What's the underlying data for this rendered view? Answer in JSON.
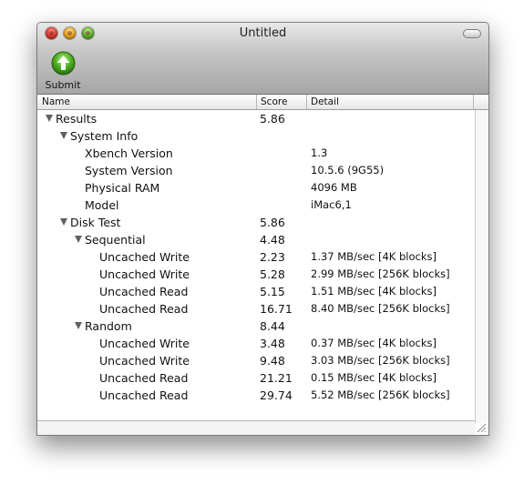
{
  "window": {
    "title": "Untitled"
  },
  "toolbar": {
    "submit_label": "Submit",
    "submit_icon": "arrow-up-icon",
    "accent": "#3e9c1f"
  },
  "table": {
    "columns": [
      "Name",
      "Score",
      "Detail"
    ],
    "rows": [
      {
        "name": "Results",
        "score": "5.86",
        "detail": "",
        "level": 0,
        "expanded": true
      },
      {
        "name": "System Info",
        "score": "",
        "detail": "",
        "level": 1,
        "expanded": true
      },
      {
        "name": "Xbench Version",
        "score": "",
        "detail": "1.3",
        "level": 2
      },
      {
        "name": "System Version",
        "score": "",
        "detail": "10.5.6 (9G55)",
        "level": 2
      },
      {
        "name": "Physical RAM",
        "score": "",
        "detail": "4096 MB",
        "level": 2
      },
      {
        "name": "Model",
        "score": "",
        "detail": "iMac6,1",
        "level": 2
      },
      {
        "name": "Disk Test",
        "score": "5.86",
        "detail": "",
        "level": 1,
        "expanded": true
      },
      {
        "name": "Sequential",
        "score": "4.48",
        "detail": "",
        "level": 2,
        "expanded": true
      },
      {
        "name": "Uncached Write",
        "score": "2.23",
        "detail": "1.37 MB/sec [4K blocks]",
        "level": 3
      },
      {
        "name": "Uncached Write",
        "score": "5.28",
        "detail": "2.99 MB/sec [256K blocks]",
        "level": 3
      },
      {
        "name": "Uncached Read",
        "score": "5.15",
        "detail": "1.51 MB/sec [4K blocks]",
        "level": 3
      },
      {
        "name": "Uncached Read",
        "score": "16.71",
        "detail": "8.40 MB/sec [256K blocks]",
        "level": 3
      },
      {
        "name": "Random",
        "score": "8.44",
        "detail": "",
        "level": 2,
        "expanded": true
      },
      {
        "name": "Uncached Write",
        "score": "3.48",
        "detail": "0.37 MB/sec [4K blocks]",
        "level": 3
      },
      {
        "name": "Uncached Write",
        "score": "9.48",
        "detail": "3.03 MB/sec [256K blocks]",
        "level": 3
      },
      {
        "name": "Uncached Read",
        "score": "21.21",
        "detail": "0.15 MB/sec [4K blocks]",
        "level": 3
      },
      {
        "name": "Uncached Read",
        "score": "29.74",
        "detail": "5.52 MB/sec [256K blocks]",
        "level": 3
      }
    ]
  }
}
